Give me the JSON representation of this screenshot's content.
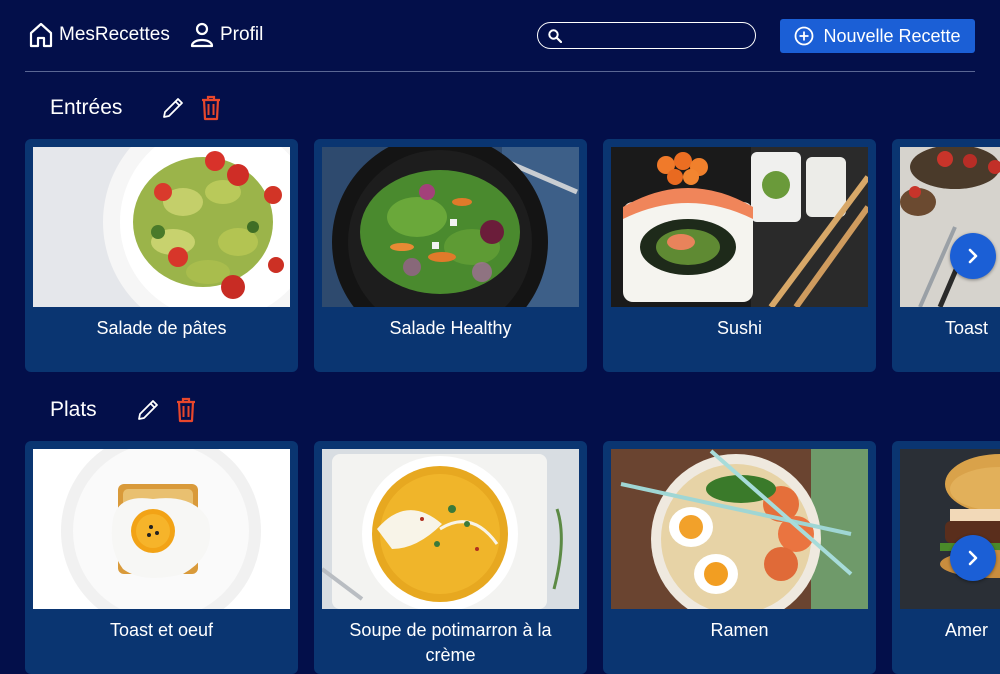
{
  "header": {
    "home_label": "MesRecettes",
    "profile_label": "Profil",
    "search_placeholder": "",
    "new_recipe_label": "Nouvelle Recette"
  },
  "sections": [
    {
      "title": "Entrées",
      "cards": [
        {
          "title": "Salade de pâtes"
        },
        {
          "title": "Salade Healthy"
        },
        {
          "title": "Sushi"
        },
        {
          "title": "Toast"
        }
      ]
    },
    {
      "title": "Plats",
      "cards": [
        {
          "title": "Toast et oeuf"
        },
        {
          "title": "Soupe de potimarron à la crème"
        },
        {
          "title": "Ramen"
        },
        {
          "title": "Amer"
        }
      ]
    }
  ],
  "colors": {
    "background": "#030f4a",
    "card": "#0a3571",
    "accent": "#1b5fd6",
    "delete": "#e8472c"
  }
}
